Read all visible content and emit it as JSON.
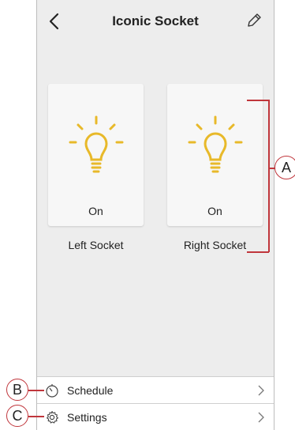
{
  "header": {
    "title": "Iconic Socket",
    "back_icon": "chevron-left-icon",
    "edit_icon": "pencil-icon"
  },
  "sockets": [
    {
      "name": "Left Socket",
      "state": "On",
      "icon": "lightbulb-icon"
    },
    {
      "name": "Right Socket",
      "state": "On",
      "icon": "lightbulb-icon"
    }
  ],
  "menu": {
    "schedule": {
      "label": "Schedule",
      "icon": "timer-icon"
    },
    "settings": {
      "label": "Settings",
      "icon": "gear-icon"
    }
  },
  "callouts": {
    "a": "A",
    "b": "B",
    "c": "C"
  },
  "colors": {
    "accent_bulb": "#e8b92a",
    "callout_line": "#c0363c",
    "background": "#ededed",
    "card": "#f7f7f7"
  }
}
